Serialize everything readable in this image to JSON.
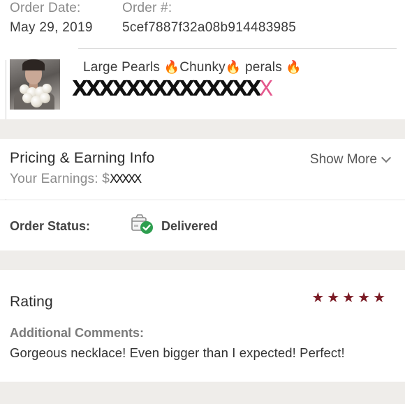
{
  "order": {
    "date_label": "Order Date:",
    "date_value": "May 29, 2019",
    "number_label": "Order #:",
    "number_value": "5cef7887f32a08b914483985"
  },
  "product": {
    "title_part1": "Large Pearls ",
    "title_part2": "Chunky",
    "title_part3": " perals ",
    "fire_icon": "🔥",
    "redacted_text": "XXXXXXXXXXXXXX",
    "redacted_tail": "X"
  },
  "pricing": {
    "heading": "Pricing & Earning Info",
    "show_more": "Show More",
    "earnings_label": "Your Earnings: $",
    "earnings_value": "XXXXX"
  },
  "status": {
    "label": "Order Status:",
    "value": "Delivered",
    "icon": "package-delivered-icon",
    "check_color": "#2e9e4f"
  },
  "rating": {
    "heading": "Rating",
    "stars": 5,
    "star_glyph": "★",
    "star_color": "#7a1a24",
    "comments_label": "Additional Comments:",
    "comments_text": "Gorgeous necklace! Even bigger than I expected! Perfect!"
  }
}
